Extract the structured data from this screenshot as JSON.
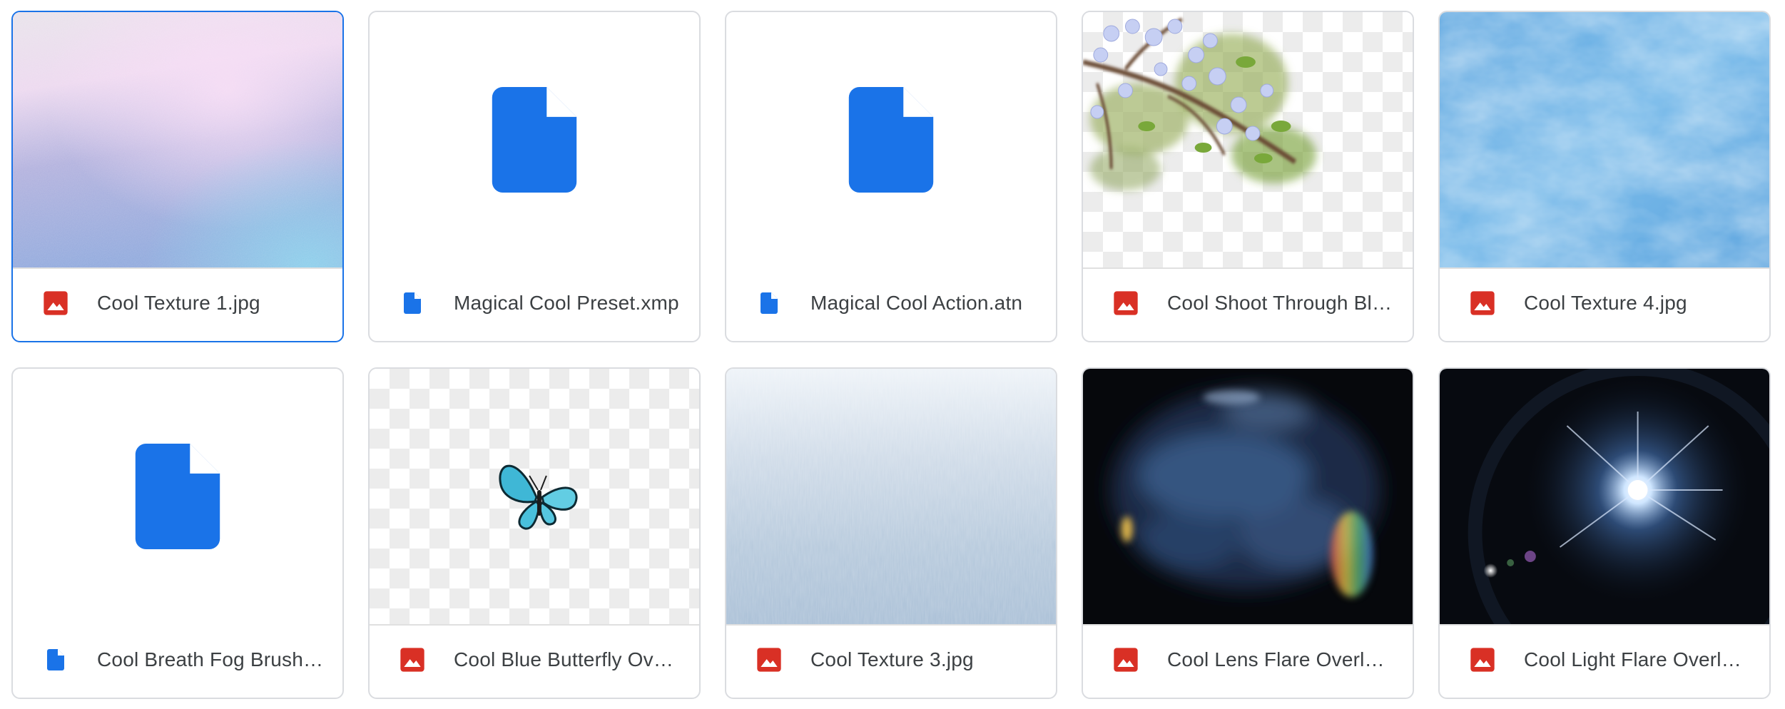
{
  "files": [
    {
      "name": "Cool Texture 1.jpg",
      "type": "image",
      "selected": true
    },
    {
      "name": "Magical Cool Preset.xmp",
      "type": "document"
    },
    {
      "name": "Magical Cool Action.atn",
      "type": "document"
    },
    {
      "name": "Cool Shoot Through Blossom.png",
      "type": "image"
    },
    {
      "name": "Cool Texture 4.jpg",
      "type": "image"
    },
    {
      "name": "Cool Breath Fog Brush.abr",
      "type": "document"
    },
    {
      "name": "Cool Blue Butterfly Overlay.png",
      "type": "image"
    },
    {
      "name": "Cool Texture 3.jpg",
      "type": "image"
    },
    {
      "name": "Cool Lens Flare Overlay.jpg",
      "type": "image"
    },
    {
      "name": "Cool Light Flare Overlay.jpg",
      "type": "image"
    }
  ],
  "colors": {
    "image_icon": "#d93025",
    "doc_icon": "#1a73e8",
    "selected_border": "#1a73e8",
    "card_border": "#dadce0",
    "label_text": "#3c4043"
  },
  "icons": {
    "image": "image-file-icon",
    "document": "document-file-icon"
  }
}
